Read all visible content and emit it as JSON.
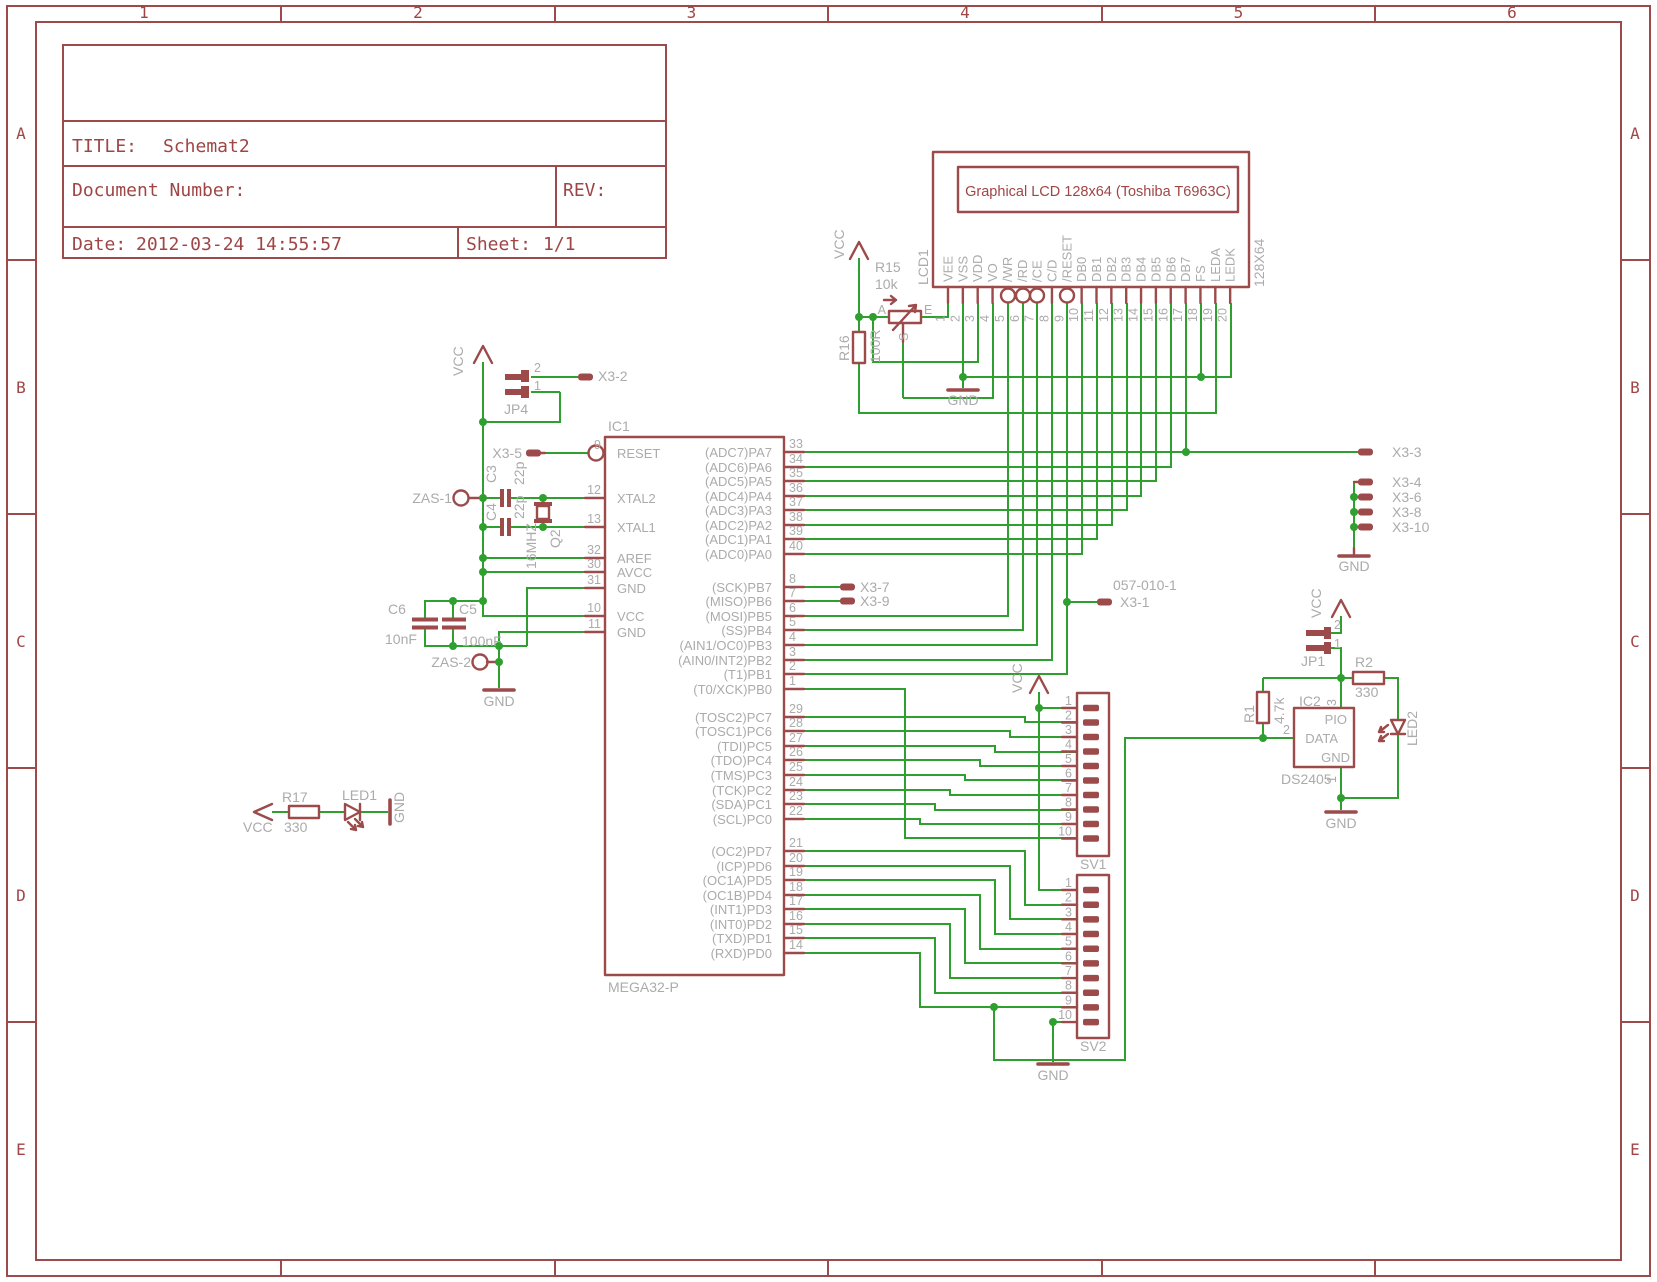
{
  "frame": {
    "columns": [
      "1",
      "2",
      "3",
      "4",
      "5",
      "6"
    ],
    "rows": [
      "A",
      "B",
      "C",
      "D",
      "E"
    ]
  },
  "title_block": {
    "title_label": "TITLE:",
    "title": "Schemat2",
    "document_label": "Document Number:",
    "rev_label": "REV:",
    "date_label": "Date:",
    "date_value": "2012-03-24 14:55:57",
    "sheet_label": "Sheet:",
    "sheet_value": "1/1"
  },
  "lcd": {
    "ref": "LCD1",
    "title": "Graphical LCD 128x64 (Toshiba T6963C)",
    "size_label": "128X64",
    "pins": [
      {
        "num": "1",
        "name": "VEE"
      },
      {
        "num": "2",
        "name": "VSS"
      },
      {
        "num": "3",
        "name": "VDD"
      },
      {
        "num": "4",
        "name": "VO"
      },
      {
        "num": "5",
        "name": "/WR"
      },
      {
        "num": "6",
        "name": "/RD"
      },
      {
        "num": "7",
        "name": "/CE"
      },
      {
        "num": "8",
        "name": "C/D"
      },
      {
        "num": "9",
        "name": "/RESET"
      },
      {
        "num": "10",
        "name": "DB0"
      },
      {
        "num": "11",
        "name": "DB1"
      },
      {
        "num": "12",
        "name": "DB2"
      },
      {
        "num": "13",
        "name": "DB3"
      },
      {
        "num": "14",
        "name": "DB4"
      },
      {
        "num": "15",
        "name": "DB5"
      },
      {
        "num": "16",
        "name": "DB6"
      },
      {
        "num": "17",
        "name": "DB7"
      },
      {
        "num": "18",
        "name": "FS"
      },
      {
        "num": "19",
        "name": "LEDA"
      },
      {
        "num": "20",
        "name": "LEDK"
      }
    ]
  },
  "mcu": {
    "ref": "IC1",
    "part": "MEGA32-P",
    "left_pins": [
      {
        "num": "9",
        "name": "RESET"
      },
      {
        "num": "12",
        "name": "XTAL2"
      },
      {
        "num": "13",
        "name": "XTAL1"
      },
      {
        "num": "32",
        "name": "AREF"
      },
      {
        "num": "30",
        "name": "AVCC"
      },
      {
        "num": "31",
        "name": "GND"
      },
      {
        "num": "10",
        "name": "VCC"
      },
      {
        "num": "11",
        "name": "GND"
      }
    ],
    "port_a": [
      {
        "num": "33",
        "name": "(ADC7)PA7"
      },
      {
        "num": "34",
        "name": "(ADC6)PA6"
      },
      {
        "num": "35",
        "name": "(ADC5)PA5"
      },
      {
        "num": "36",
        "name": "(ADC4)PA4"
      },
      {
        "num": "37",
        "name": "(ADC3)PA3"
      },
      {
        "num": "38",
        "name": "(ADC2)PA2"
      },
      {
        "num": "39",
        "name": "(ADC1)PA1"
      },
      {
        "num": "40",
        "name": "(ADC0)PA0"
      }
    ],
    "port_b": [
      {
        "num": "8",
        "name": "(SCK)PB7"
      },
      {
        "num": "7",
        "name": "(MISO)PB6"
      },
      {
        "num": "6",
        "name": "(MOSI)PB5"
      },
      {
        "num": "5",
        "name": "(SS)PB4"
      },
      {
        "num": "4",
        "name": "(AIN1/OC0)PB3"
      },
      {
        "num": "3",
        "name": "(AIN0/INT2)PB2"
      },
      {
        "num": "2",
        "name": "(T1)PB1"
      },
      {
        "num": "1",
        "name": "(T0/XCK)PB0"
      }
    ],
    "port_c": [
      {
        "num": "29",
        "name": "(TOSC2)PC7"
      },
      {
        "num": "28",
        "name": "(TOSC1)PC6"
      },
      {
        "num": "27",
        "name": "(TDI)PC5"
      },
      {
        "num": "26",
        "name": "(TDO)PC4"
      },
      {
        "num": "25",
        "name": "(TMS)PC3"
      },
      {
        "num": "24",
        "name": "(TCK)PC2"
      },
      {
        "num": "23",
        "name": "(SDA)PC1"
      },
      {
        "num": "22",
        "name": "(SCL)PC0"
      }
    ],
    "port_d": [
      {
        "num": "21",
        "name": "(OC2)PD7"
      },
      {
        "num": "20",
        "name": "(ICP)PD6"
      },
      {
        "num": "19",
        "name": "(OC1A)PD5"
      },
      {
        "num": "18",
        "name": "(OC1B)PD4"
      },
      {
        "num": "17",
        "name": "(INT1)PD3"
      },
      {
        "num": "16",
        "name": "(INT0)PD2"
      },
      {
        "num": "15",
        "name": "(TXD)PD1"
      },
      {
        "num": "14",
        "name": "(RXD)PD0"
      }
    ]
  },
  "headers": {
    "sv1_ref": "SV1",
    "sv2_ref": "SV2",
    "pin_numbers": [
      "1",
      "2",
      "3",
      "4",
      "5",
      "6",
      "7",
      "8",
      "9",
      "10"
    ]
  },
  "onewire": {
    "ic_ref": "IC2",
    "ic_part": "DS2405",
    "pin_pio": "PIO",
    "pin_data": "DATA",
    "pin_gnd": "GND",
    "num_pio": "3",
    "num_data": "2",
    "num_gnd": "1",
    "r1_ref": "R1",
    "r1_value": "4.7k",
    "r2_ref": "R2",
    "r2_value": "330",
    "led_ref": "LED2",
    "jp_ref": "JP1",
    "jp_pin_top": "2",
    "jp_pin_bottom": "1"
  },
  "contrast": {
    "pot_ref": "R15",
    "pot_value": "10k",
    "term_a": "A",
    "term_e": "E",
    "term_s": "S",
    "r16_ref": "R16",
    "r16_value": "100R"
  },
  "power_led": {
    "r_ref": "R17",
    "r_value": "330",
    "led_ref": "LED1"
  },
  "crystal": {
    "ref": "Q2",
    "value": "16MHZ",
    "c3_ref": "C3",
    "c3_value": "22p",
    "c4_ref": "C4",
    "c4_value": "22p"
  },
  "decoupling": {
    "c5_ref": "C5",
    "c5_value": "100nF",
    "c6_ref": "C6",
    "c6_value": "10nF"
  },
  "power_taps": {
    "zas1": "ZAS-1",
    "zas2": "ZAS-2",
    "jp4_ref": "JP4",
    "jp4_pin_top": "2",
    "jp4_pin_bottom": "1"
  },
  "x3": {
    "part_number": "057-010-1",
    "pads": {
      "x3_1": "X3-1",
      "x3_2": "X3-2",
      "x3_3": "X3-3",
      "x3_4": "X3-4",
      "x3_5": "X3-5",
      "x3_6": "X3-6",
      "x3_7": "X3-7",
      "x3_8": "X3-8",
      "x3_9": "X3-9",
      "x3_10": "X3-10"
    }
  },
  "net_labels": {
    "vcc": "VCC",
    "gnd": "GND"
  },
  "colors": {
    "wire_green": "#2fa02f",
    "symbol_maroon": "#9c4a4a",
    "label_gray": "#ababab"
  }
}
